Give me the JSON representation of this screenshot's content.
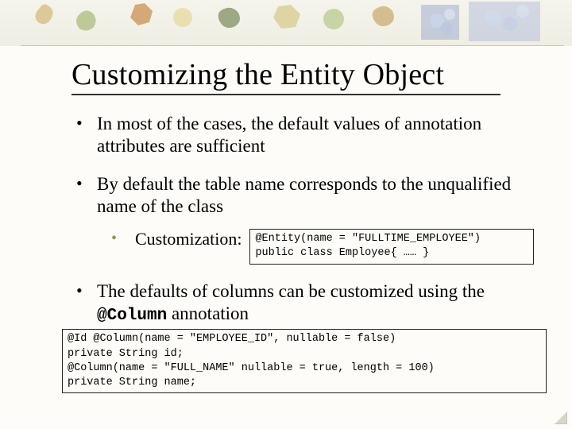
{
  "title": "Customizing the Entity Object",
  "bullets": {
    "b1": "In most of the cases, the default values of annotation attributes are sufficient",
    "b2": "By default the table name corresponds to the unqualified name of the class",
    "b2_sub_label": "Customization:",
    "b2_sub_code": "@Entity(name = \"FULLTIME_EMPLOYEE\")\npublic class Employee{ …… }",
    "b3_pre": "The defaults of columns can be customized using the ",
    "b3_mono": "@Column",
    "b3_post": " annotation",
    "b3_code": "@Id @Column(name = \"EMPLOYEE_ID\", nullable = false)\nprivate String id;\n@Column(name = \"FULL_NAME\" nullable = true, length = 100)\nprivate String name;"
  }
}
